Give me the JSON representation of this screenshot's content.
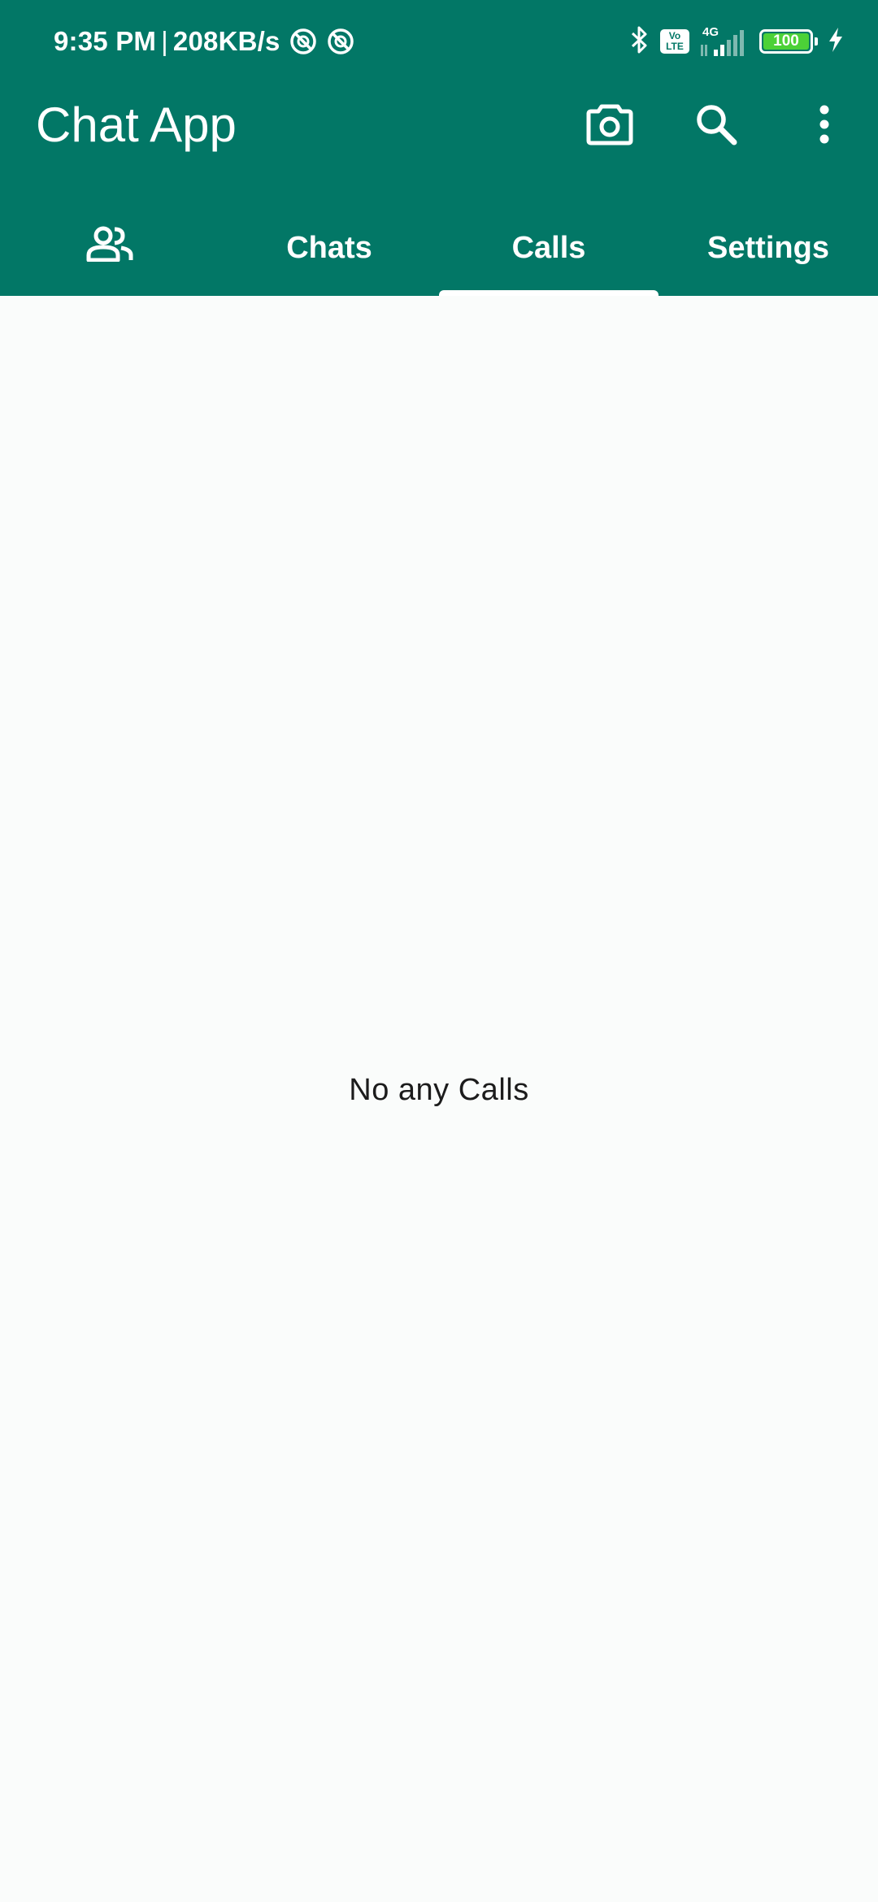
{
  "status_bar": {
    "time": "9:35 PM",
    "separator": "|",
    "speed": "208KB/s",
    "volte_top": "Vo",
    "volte_bottom": "LTE",
    "network": "4G",
    "battery": "100",
    "icons": [
      "dnd-icon",
      "dnd-icon",
      "bluetooth-icon",
      "volte-icon",
      "signal-icon",
      "battery-icon",
      "charging-icon"
    ]
  },
  "app_bar": {
    "title": "Chat App",
    "actions": [
      "camera-icon",
      "search-icon",
      "more-vert-icon"
    ]
  },
  "tabs": [
    {
      "label": "",
      "icon": "people-icon",
      "active": false
    },
    {
      "label": "Chats",
      "active": false
    },
    {
      "label": "Calls",
      "active": true
    },
    {
      "label": "Settings",
      "active": false
    }
  ],
  "main": {
    "empty_message": "No any Calls"
  },
  "colors": {
    "primary": "#027766",
    "background": "#fafcfb",
    "indicator": "#ffffff",
    "battery_fill": "#4cd137"
  }
}
